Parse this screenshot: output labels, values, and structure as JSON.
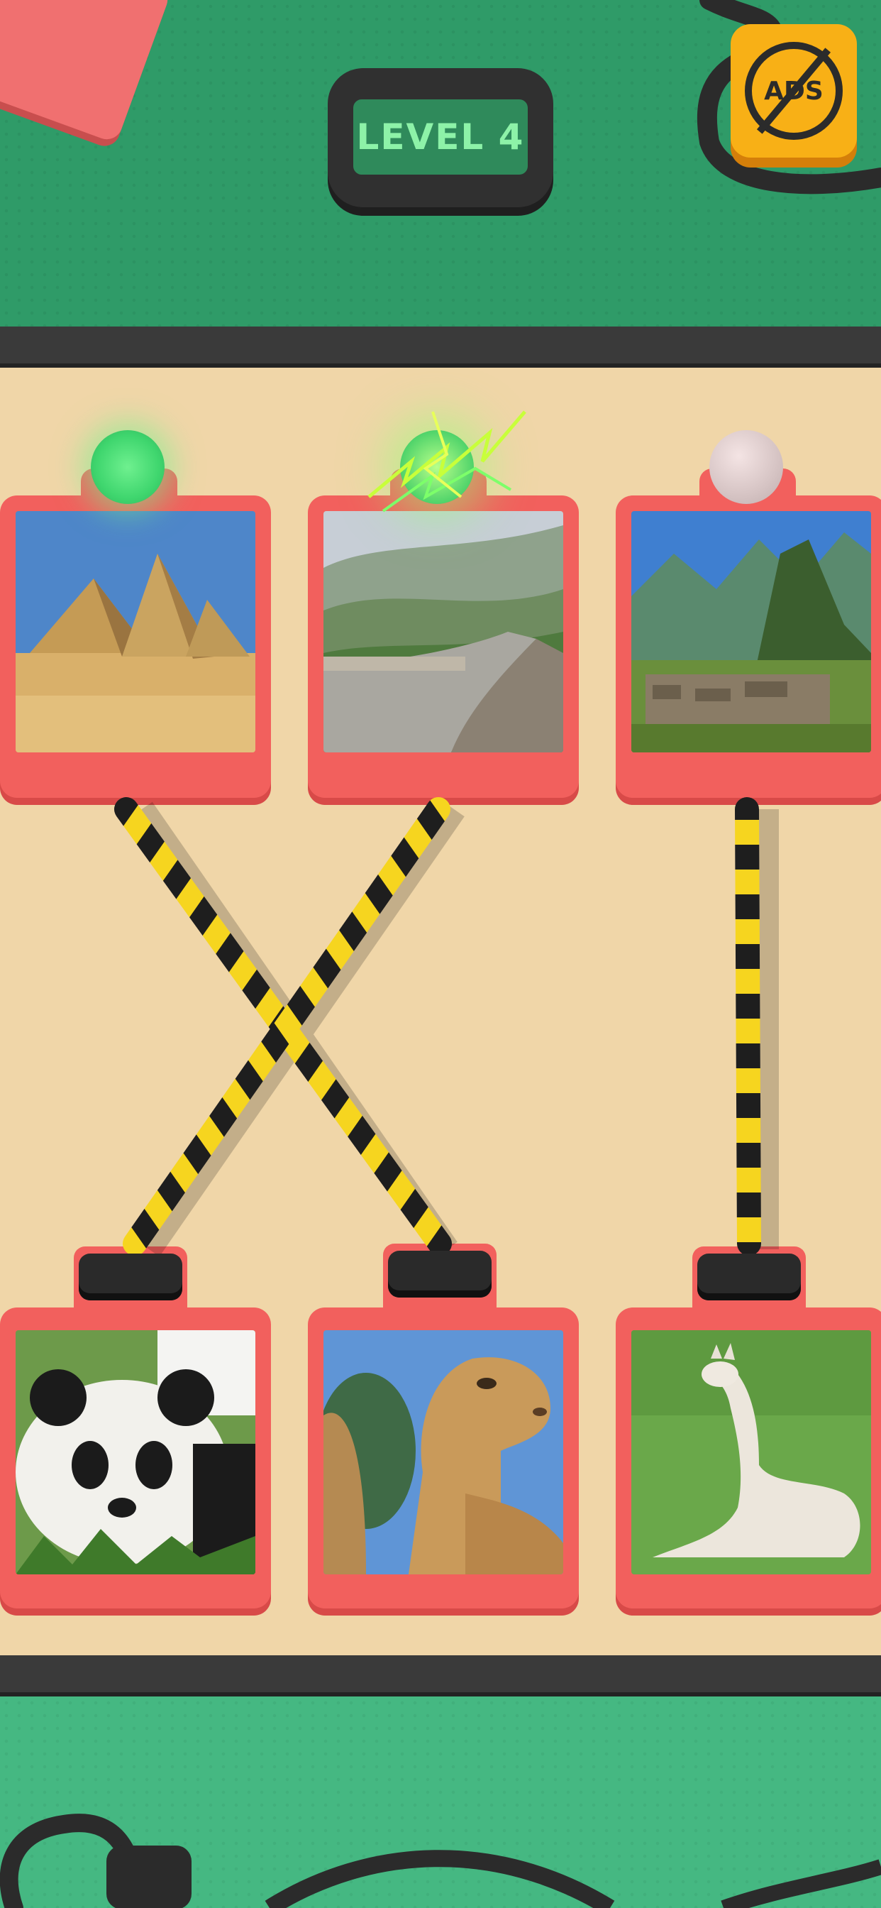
{
  "header": {
    "level_label": "LEVEL 4"
  },
  "ads_button": {
    "label": "ADS",
    "icon": "no-ads-icon"
  },
  "top_items": [
    {
      "name": "pyramids",
      "bulb": "lit-green"
    },
    {
      "name": "great-wall",
      "bulb": "sparking"
    },
    {
      "name": "machu-picchu",
      "bulb": "off-grey"
    }
  ],
  "bottom_items": [
    {
      "name": "panda"
    },
    {
      "name": "camel"
    },
    {
      "name": "llama"
    }
  ],
  "connections": [
    {
      "from": "pyramids",
      "to": "camel"
    },
    {
      "from": "great-wall",
      "to": "panda"
    },
    {
      "from": "machu-picchu",
      "to": "llama"
    }
  ],
  "colors": {
    "board": "#f0d6a8",
    "panel": "#f2605d",
    "top_bar": "#2f9b68",
    "bottom_bar": "#45b882",
    "wire_yellow": "#f6d51f",
    "wire_black": "#1e1e1e",
    "ads": "#f8b016"
  }
}
